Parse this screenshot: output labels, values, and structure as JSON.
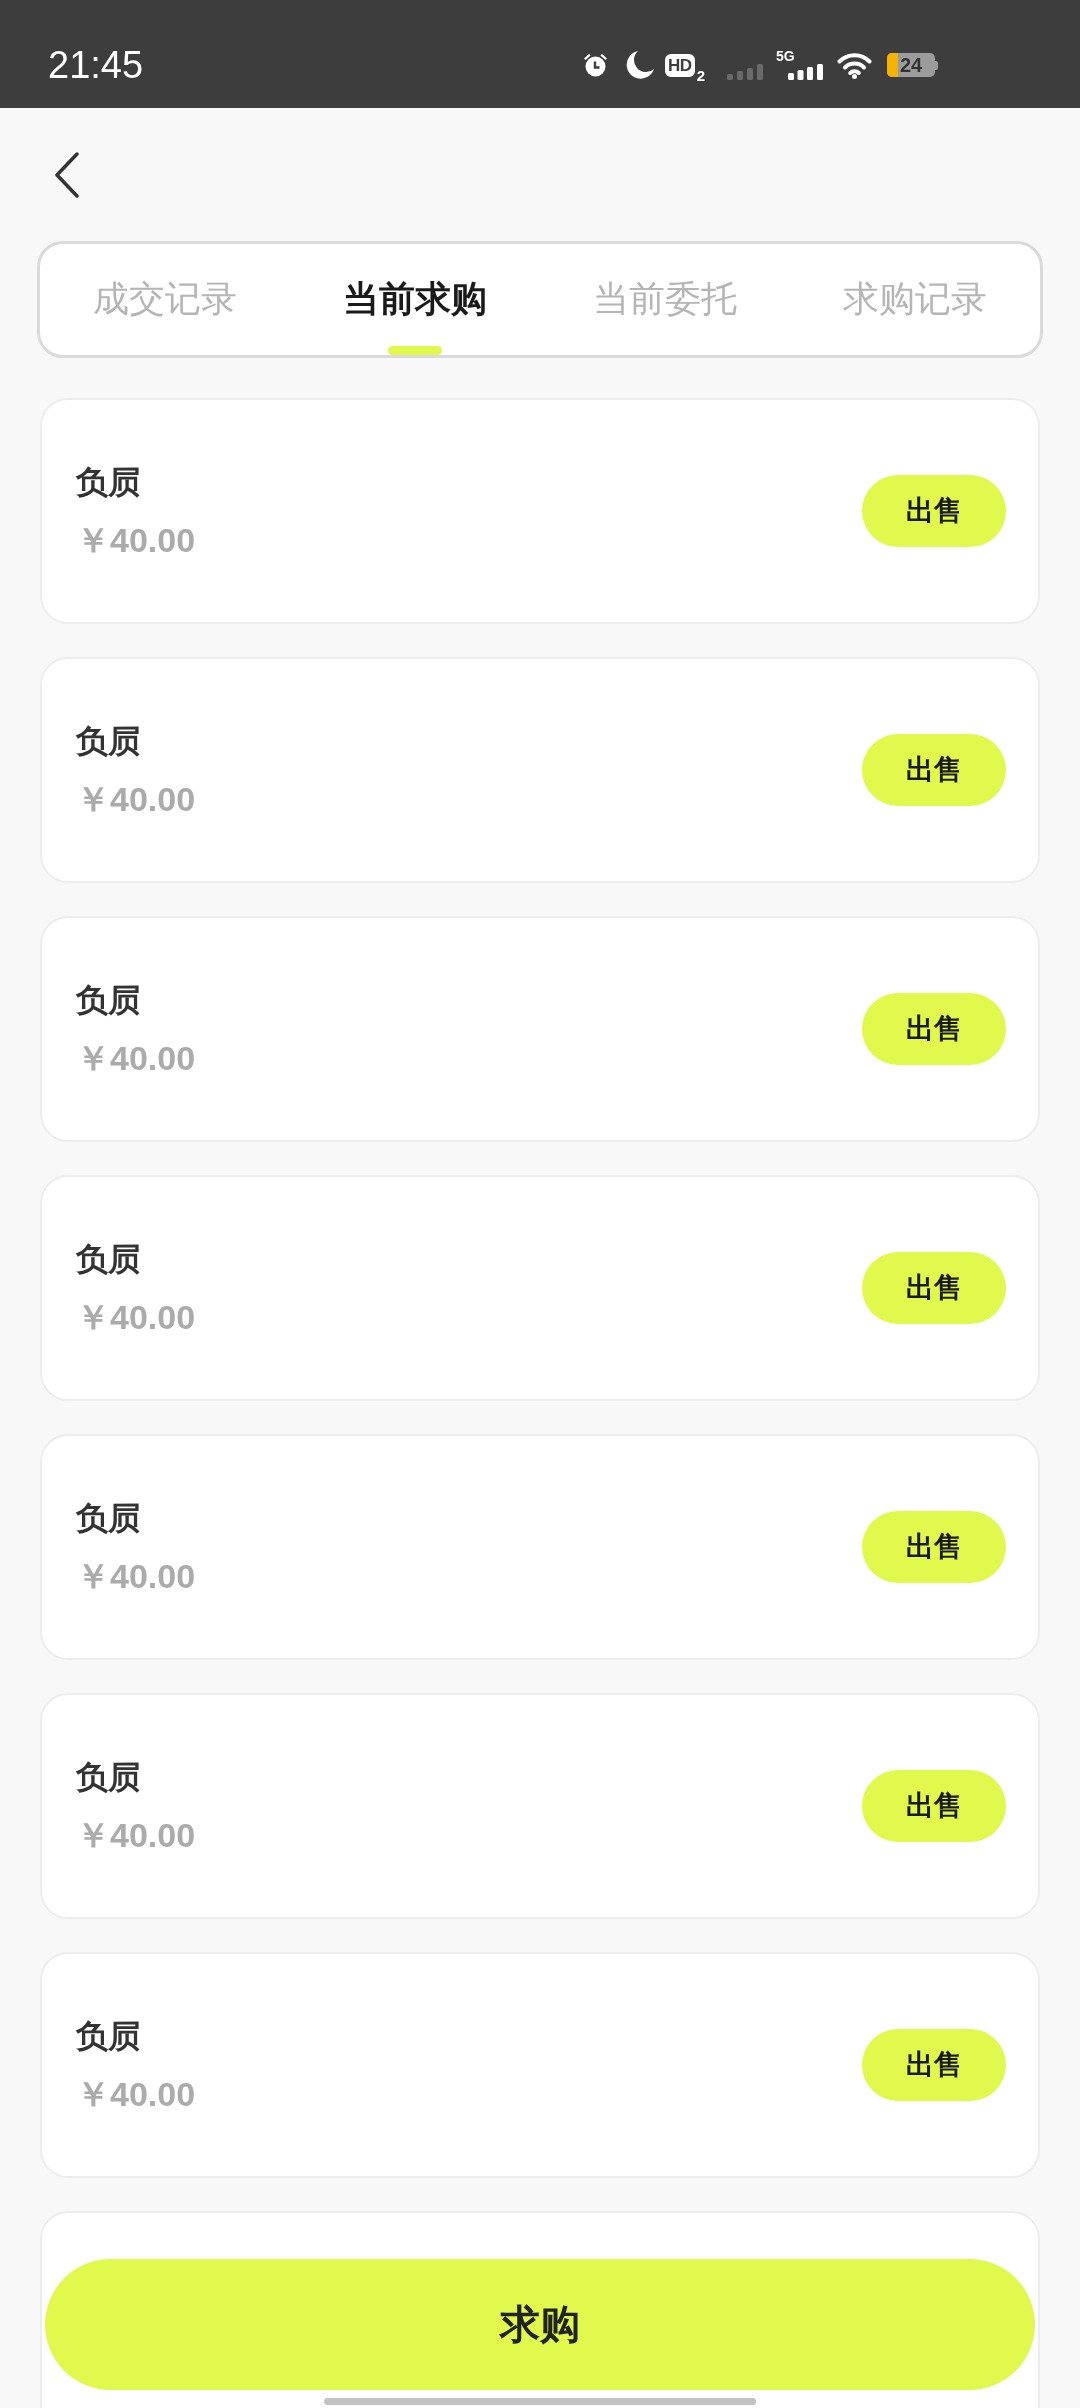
{
  "status_bar": {
    "time": "21:45",
    "hd_label": "HD",
    "hd_sub": "2",
    "network": "5G",
    "battery": "24"
  },
  "tabs": [
    {
      "label": "成交记录",
      "selected": false
    },
    {
      "label": "当前求购",
      "selected": true
    },
    {
      "label": "当前委托",
      "selected": false
    },
    {
      "label": "求购记录",
      "selected": false
    }
  ],
  "orders": [
    {
      "name": "负屃",
      "price": "￥40.00",
      "action": "出售"
    },
    {
      "name": "负屃",
      "price": "￥40.00",
      "action": "出售"
    },
    {
      "name": "负屃",
      "price": "￥40.00",
      "action": "出售"
    },
    {
      "name": "负屃",
      "price": "￥40.00",
      "action": "出售"
    },
    {
      "name": "负屃",
      "price": "￥40.00",
      "action": "出售"
    },
    {
      "name": "负屃",
      "price": "￥40.00",
      "action": "出售"
    },
    {
      "name": "负屃",
      "price": "￥40.00",
      "action": "出售"
    }
  ],
  "primary_button": "求购"
}
